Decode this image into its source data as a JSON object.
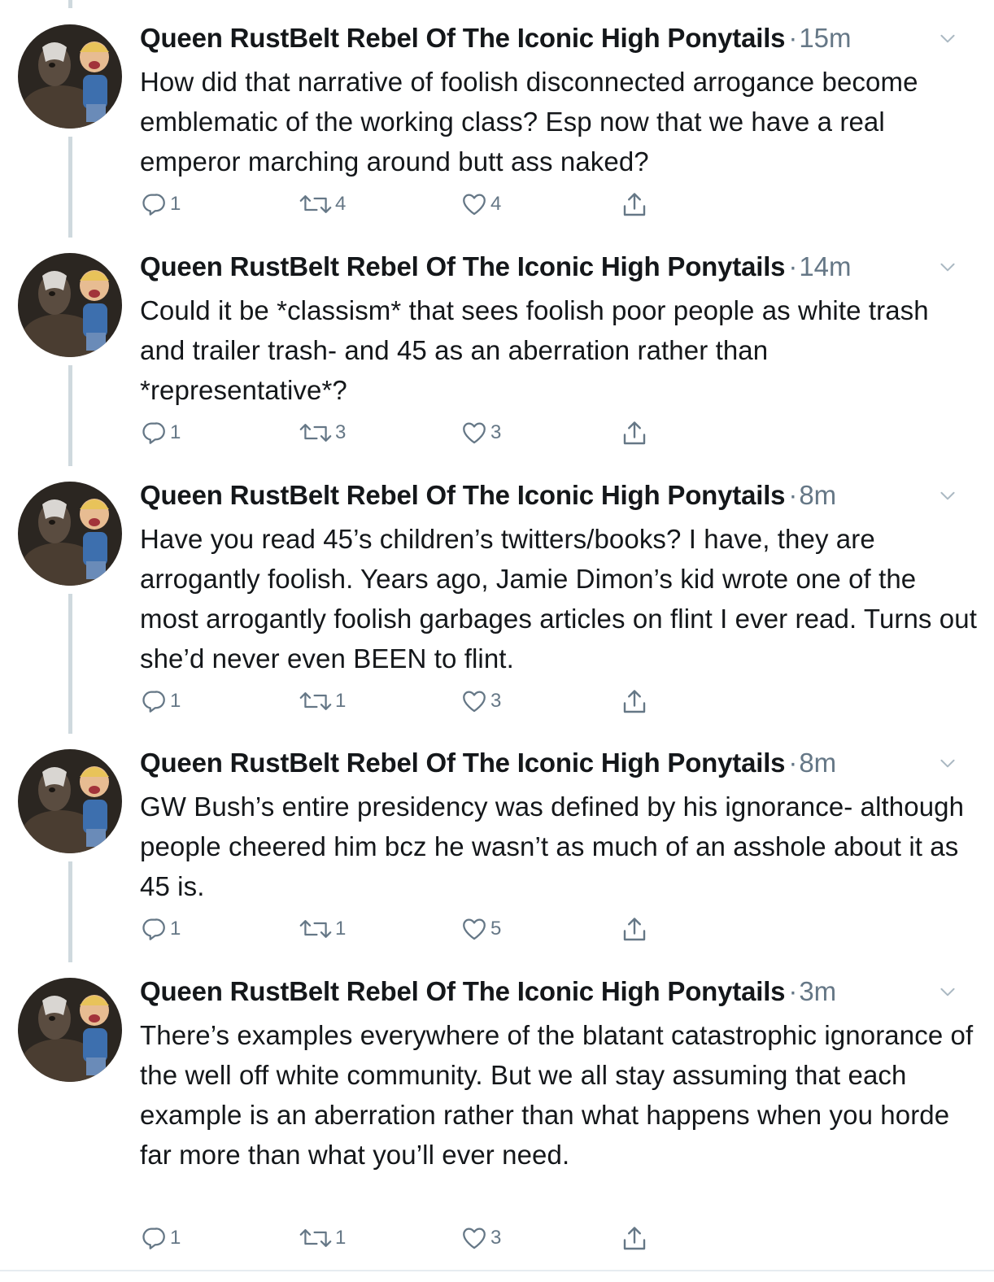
{
  "thread": {
    "tweets": [
      {
        "author": "Queen RustBelt Rebel Of The Iconic High Ponytails",
        "separator": "·",
        "time": "15m",
        "text": "How did that narrative of foolish disconnected arrogance become emblematic of the working class? Esp now that we have a real emperor marching around butt ass naked?",
        "replies": "1",
        "retweets": "4",
        "likes": "4"
      },
      {
        "author": "Queen RustBelt Rebel Of The Iconic High Ponytails",
        "separator": "·",
        "time": "14m",
        "text": "Could it be *classism* that sees foolish poor people as white trash and trailer trash- and 45 as an aberration rather than *representative*?",
        "replies": "1",
        "retweets": "3",
        "likes": "3"
      },
      {
        "author": "Queen RustBelt Rebel Of The Iconic High Ponytails",
        "separator": "·",
        "time": "8m",
        "text": "Have you read 45’s children’s twitters/books? I have, they are arrogantly foolish. Years ago, Jamie Dimon’s kid wrote one of the most arrogantly foolish garbages articles on flint I ever read. Turns out she’d never even BEEN to flint.",
        "replies": "1",
        "retweets": "1",
        "likes": "3"
      },
      {
        "author": "Queen RustBelt Rebel Of The Iconic High Ponytails",
        "separator": "·",
        "time": "8m",
        "text": "GW Bush’s entire presidency was defined by his ignorance- although people cheered him bcz he wasn’t as much of an asshole about it as 45 is.",
        "replies": "1",
        "retweets": "1",
        "likes": "5"
      },
      {
        "author": "Queen RustBelt Rebel Of The Iconic High Ponytails",
        "separator": "·",
        "time": "3m",
        "text": "There’s examples everywhere of the blatant catastrophic ignorance of the well off white community. But we all stay assuming that each example is an aberration rather than what happens when you horde far more than what you’ll ever need.",
        "replies": "1",
        "retweets": "1",
        "likes": "3"
      }
    ]
  },
  "icons": {
    "reply": "reply-icon",
    "retweet": "retweet-icon",
    "like": "heart-icon",
    "share": "share-icon",
    "menu": "chevron-down-icon"
  },
  "colors": {
    "text": "#14171a",
    "muted": "#657786",
    "thread_line": "#cfd9de"
  }
}
